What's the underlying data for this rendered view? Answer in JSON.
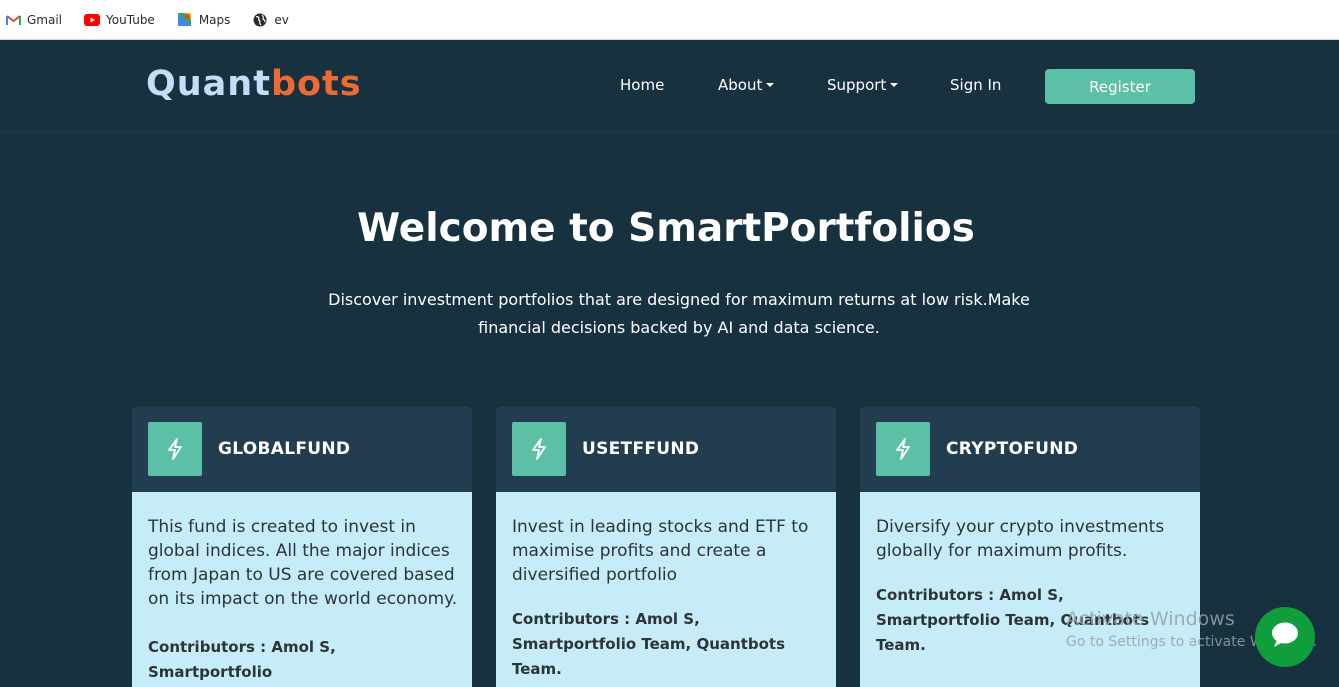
{
  "bookmarks": [
    {
      "label": "Gmail",
      "icon": "gmail-icon"
    },
    {
      "label": "YouTube",
      "icon": "youtube-icon"
    },
    {
      "label": "Maps",
      "icon": "maps-icon"
    },
    {
      "label": "ev",
      "icon": "globe-icon"
    }
  ],
  "brand": {
    "part1": "Quant",
    "part2": "bots",
    "color1": "#c7dcf6",
    "color2": "#ee6a35"
  },
  "nav": {
    "home": "Home",
    "about": "About",
    "support": "Support",
    "signin": "Sign In",
    "register": "Register"
  },
  "hero": {
    "title": "Welcome to SmartPortfolios",
    "subtitle": "Discover investment portfolios that are designed for maximum returns at low risk.Make financial decisions backed by AI and data science."
  },
  "cards": [
    {
      "title": "GLOBALFUND",
      "icon": "lightning-icon",
      "description": "This fund is created to invest in global indices. All the major indices from Japan to US are covered based on its impact on the world economy.",
      "contributors": "Contributors : Amol S, Smartportfolio"
    },
    {
      "title": "USETFFUND",
      "icon": "lightning-icon",
      "description": "Invest in leading stocks and ETF to maximise profits and create a diversified portfolio",
      "contributors": "Contributors : Amol S, Smartportfolio Team, Quantbots Team."
    },
    {
      "title": "CRYPTOFUND",
      "icon": "lightning-icon",
      "description": "Diversify your crypto investments globally for maximum profits.",
      "contributors": "Contributors : Amol S, Smartportfolio Team, Quantbots Team."
    }
  ],
  "watermark": {
    "line1": "Activate Windows",
    "line2": "Go to Settings to activate Windows."
  },
  "colors": {
    "background": "#17313f",
    "accent": "#5cc0a6",
    "card_body": "#c6ecfa",
    "card_head": "#223d4f",
    "chat": "#109d3c"
  }
}
